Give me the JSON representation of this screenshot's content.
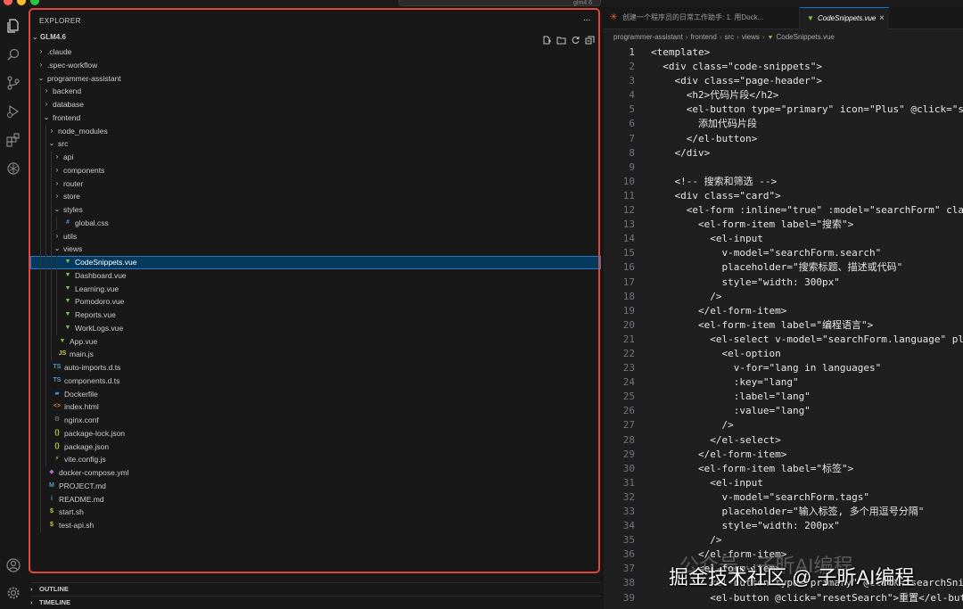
{
  "window": {
    "title": "glm4.6"
  },
  "explorer": {
    "title": "EXPLORER",
    "more": "...",
    "root": "GLM4.6",
    "items": [
      {
        "label": ".claude",
        "depth": 0,
        "kind": "folder",
        "open": false
      },
      {
        "label": ".spec-workflow",
        "depth": 0,
        "kind": "folder",
        "open": false
      },
      {
        "label": "programmer-assistant",
        "depth": 0,
        "kind": "folder",
        "open": true
      },
      {
        "label": "backend",
        "depth": 1,
        "kind": "folder",
        "open": false
      },
      {
        "label": "database",
        "depth": 1,
        "kind": "folder",
        "open": false
      },
      {
        "label": "frontend",
        "depth": 1,
        "kind": "folder",
        "open": true
      },
      {
        "label": "node_modules",
        "depth": 2,
        "kind": "folder",
        "open": false
      },
      {
        "label": "src",
        "depth": 2,
        "kind": "folder",
        "open": true
      },
      {
        "label": "api",
        "depth": 3,
        "kind": "folder",
        "open": false
      },
      {
        "label": "components",
        "depth": 3,
        "kind": "folder",
        "open": false
      },
      {
        "label": "router",
        "depth": 3,
        "kind": "folder",
        "open": false
      },
      {
        "label": "store",
        "depth": 3,
        "kind": "folder",
        "open": false
      },
      {
        "label": "styles",
        "depth": 3,
        "kind": "folder",
        "open": true
      },
      {
        "label": "global.css",
        "depth": 4,
        "kind": "css"
      },
      {
        "label": "utils",
        "depth": 3,
        "kind": "folder",
        "open": false
      },
      {
        "label": "views",
        "depth": 3,
        "kind": "folder",
        "open": true
      },
      {
        "label": "CodeSnippets.vue",
        "depth": 4,
        "kind": "vue",
        "selected": true
      },
      {
        "label": "Dashboard.vue",
        "depth": 4,
        "kind": "vue"
      },
      {
        "label": "Learning.vue",
        "depth": 4,
        "kind": "vue"
      },
      {
        "label": "Pomodoro.vue",
        "depth": 4,
        "kind": "vue"
      },
      {
        "label": "Reports.vue",
        "depth": 4,
        "kind": "vue"
      },
      {
        "label": "WorkLogs.vue",
        "depth": 4,
        "kind": "vue"
      },
      {
        "label": "App.vue",
        "depth": 3,
        "kind": "vue"
      },
      {
        "label": "main.js",
        "depth": 3,
        "kind": "js"
      },
      {
        "label": "auto-imports.d.ts",
        "depth": 2,
        "kind": "ts"
      },
      {
        "label": "components.d.ts",
        "depth": 2,
        "kind": "ts"
      },
      {
        "label": "Dockerfile",
        "depth": 2,
        "kind": "docker"
      },
      {
        "label": "index.html",
        "depth": 2,
        "kind": "html"
      },
      {
        "label": "nginx.conf",
        "depth": 2,
        "kind": "conf"
      },
      {
        "label": "package-lock.json",
        "depth": 2,
        "kind": "json"
      },
      {
        "label": "package.json",
        "depth": 2,
        "kind": "json"
      },
      {
        "label": "vite.config.js",
        "depth": 2,
        "kind": "vite"
      },
      {
        "label": "docker-compose.yml",
        "depth": 1,
        "kind": "yml"
      },
      {
        "label": "PROJECT.md",
        "depth": 1,
        "kind": "md"
      },
      {
        "label": "README.md",
        "depth": 1,
        "kind": "info"
      },
      {
        "label": "start.sh",
        "depth": 1,
        "kind": "sh"
      },
      {
        "label": "test-api.sh",
        "depth": 1,
        "kind": "sh"
      }
    ],
    "outline": "OUTLINE",
    "timeline": "TIMELINE"
  },
  "icon_glyphs": {
    "css": "#",
    "js": "JS",
    "ts": "TS",
    "html": "<>",
    "json": "{}",
    "sh": "$",
    "md": "M",
    "info": "i",
    "conf": "⚙",
    "vite": "⚡",
    "docker": "▰",
    "yml": "◆",
    "vue": "▼"
  },
  "icon_colors": {
    "css": "#519aba",
    "js": "#cbcb41",
    "ts": "#519aba",
    "html": "#e37933",
    "json": "#cbcb41",
    "sh": "#cbcb41",
    "md": "#519aba",
    "info": "#519aba",
    "conf": "#8a8a8a",
    "vite": "#f5c542",
    "docker": "#4a90d9",
    "yml": "#a074c4",
    "vue": "#8dc149"
  },
  "tabs": [
    {
      "label": "创建一个程序员的日常工作助手: 1. 用Dock...",
      "active": false
    },
    {
      "label": "CodeSnippets.vue",
      "active": true,
      "close": "×"
    }
  ],
  "breadcrumb": [
    "programmer-assistant",
    "frontend",
    "src",
    "views",
    "CodeSnippets.vue"
  ],
  "breadcrumb_sep": "›",
  "editor": {
    "lines": [
      {
        "n": 1,
        "text": "<template>"
      },
      {
        "n": 2,
        "text": "  <div class=\"code-snippets\">"
      },
      {
        "n": 3,
        "text": "    <div class=\"page-header\">"
      },
      {
        "n": 4,
        "text": "      <h2>代码片段</h2>"
      },
      {
        "n": 5,
        "text": "      <el-button type=\"primary\" icon=\"Plus\" @click=\"sho"
      },
      {
        "n": 6,
        "text": "        添加代码片段"
      },
      {
        "n": 7,
        "text": "      </el-button>"
      },
      {
        "n": 8,
        "text": "    </div>"
      },
      {
        "n": 9,
        "text": ""
      },
      {
        "n": 10,
        "text": "    <!-- 搜索和筛选 -->"
      },
      {
        "n": 11,
        "text": "    <div class=\"card\">"
      },
      {
        "n": 12,
        "text": "      <el-form :inline=\"true\" :model=\"searchForm\" clas"
      },
      {
        "n": 13,
        "text": "        <el-form-item label=\"搜索\">"
      },
      {
        "n": 14,
        "text": "          <el-input"
      },
      {
        "n": 15,
        "text": "            v-model=\"searchForm.search\""
      },
      {
        "n": 16,
        "text": "            placeholder=\"搜索标题、描述或代码\""
      },
      {
        "n": 17,
        "text": "            style=\"width: 300px\""
      },
      {
        "n": 18,
        "text": "          />"
      },
      {
        "n": 19,
        "text": "        </el-form-item>"
      },
      {
        "n": 20,
        "text": "        <el-form-item label=\"编程语言\">"
      },
      {
        "n": 21,
        "text": "          <el-select v-model=\"searchForm.language\" plac"
      },
      {
        "n": 22,
        "text": "            <el-option"
      },
      {
        "n": 23,
        "text": "              v-for=\"lang in languages\""
      },
      {
        "n": 24,
        "text": "              :key=\"lang\""
      },
      {
        "n": 25,
        "text": "              :label=\"lang\""
      },
      {
        "n": 26,
        "text": "              :value=\"lang\""
      },
      {
        "n": 27,
        "text": "            />"
      },
      {
        "n": 28,
        "text": "          </el-select>"
      },
      {
        "n": 29,
        "text": "        </el-form-item>"
      },
      {
        "n": 30,
        "text": "        <el-form-item label=\"标签\">"
      },
      {
        "n": 31,
        "text": "          <el-input"
      },
      {
        "n": 32,
        "text": "            v-model=\"searchForm.tags\""
      },
      {
        "n": 33,
        "text": "            placeholder=\"输入标签, 多个用逗号分隔\""
      },
      {
        "n": 34,
        "text": "            style=\"width: 200px\""
      },
      {
        "n": 35,
        "text": "          />"
      },
      {
        "n": 36,
        "text": "        </el-form-item>"
      },
      {
        "n": 37,
        "text": "        <el-form-item>"
      },
      {
        "n": 38,
        "text": "          <el-button type=\"primary\" @click=\"searchSnipp"
      },
      {
        "n": 39,
        "text": "          <el-button @click=\"resetSearch\">重置</el-butt"
      }
    ]
  },
  "watermark": {
    "main": "掘金技术社区 @ 子昕AI编程",
    "faint": "公众号 · 子昕AI编程"
  }
}
